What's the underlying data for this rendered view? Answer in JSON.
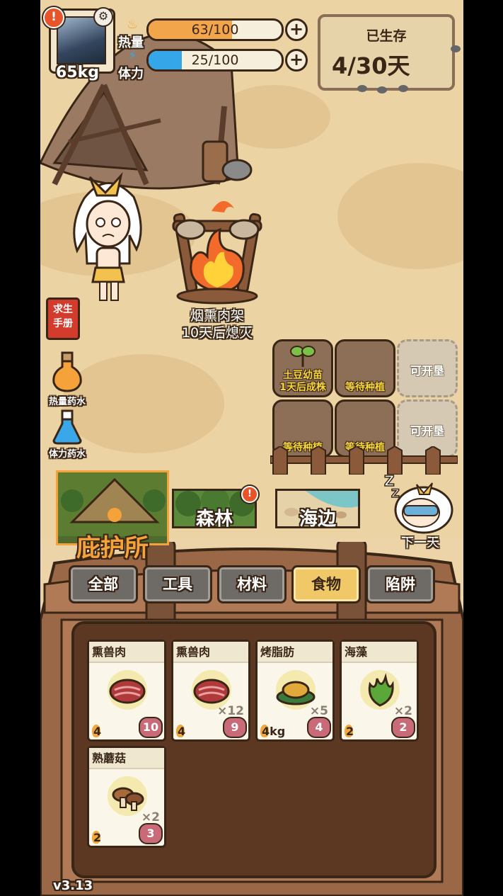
{
  "player": {
    "weight": "65kg",
    "heat_label": "热量",
    "heat_value": "63/100",
    "heat_fraction": 0.63,
    "stamina_label": "体力",
    "stamina_value": "25/100",
    "stamina_fraction": 0.25
  },
  "survival": {
    "title": "已生存",
    "days": "4/30天"
  },
  "campfire": {
    "name": "烟熏肉架",
    "status": "10天后熄灭"
  },
  "side": {
    "manual": "求生手册",
    "heat_potion": "热量药水",
    "stamina_potion": "体力药水"
  },
  "plots": [
    {
      "label": "土豆幼苗\n1天后成株",
      "state": "growing"
    },
    {
      "label": "等待种植",
      "state": "empty"
    },
    {
      "label": "可开垦",
      "state": "locked"
    },
    {
      "label": "等待种植",
      "state": "empty"
    },
    {
      "label": "等待种植",
      "state": "empty"
    },
    {
      "label": "可开垦",
      "state": "locked"
    }
  ],
  "locations": {
    "shelter": "庇护所",
    "forest": "森林",
    "seaside": "海边"
  },
  "next_day": "下一天",
  "tabs": [
    {
      "label": "全部",
      "active": false
    },
    {
      "label": "工具",
      "active": false
    },
    {
      "label": "材料",
      "active": false
    },
    {
      "label": "食物",
      "active": true
    },
    {
      "label": "陷阱",
      "active": false
    }
  ],
  "items": [
    {
      "name": "熏兽肉",
      "count": "",
      "heat": "4",
      "food": "10",
      "icon": "smoked-meat-icon"
    },
    {
      "name": "熏兽肉",
      "count": "×12",
      "heat": "4",
      "food": "9",
      "icon": "smoked-meat-icon"
    },
    {
      "name": "烤脂肪",
      "count": "×5",
      "heat": "4kg",
      "food": "4",
      "icon": "roasted-fat-icon"
    },
    {
      "name": "海藻",
      "count": "×2",
      "heat": "2",
      "food": "2",
      "icon": "seaweed-icon"
    },
    {
      "name": "熟蘑菇",
      "count": "×2",
      "heat": "2",
      "food": "3",
      "icon": "mushroom-icon"
    }
  ],
  "version": "v3.13",
  "colors": {
    "heat_bar": "#f2a54a",
    "stamina_bar": "#35a7e8",
    "active_tab": "#f0c868",
    "shelter_label": "#f5a23a"
  }
}
